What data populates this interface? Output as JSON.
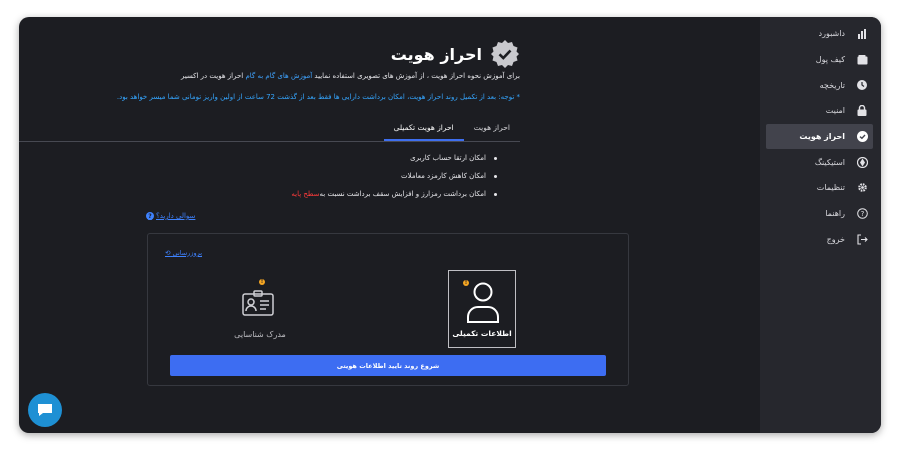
{
  "sidebar": {
    "items": [
      {
        "label": "داشبورد",
        "icon": "bar-chart-icon"
      },
      {
        "label": "کیف پول",
        "icon": "wallet-icon"
      },
      {
        "label": "تاریخچه",
        "icon": "clock-icon"
      },
      {
        "label": "امنیت",
        "icon": "lock-icon"
      },
      {
        "label": "احراز هویت",
        "icon": "check-circle-icon",
        "active": true
      },
      {
        "label": "استیکینگ",
        "icon": "staking-icon"
      },
      {
        "label": "تنظیمات",
        "icon": "gear-icon"
      },
      {
        "label": "راهنما",
        "icon": "help-icon"
      },
      {
        "label": "خروج",
        "icon": "logout-icon"
      }
    ]
  },
  "header": {
    "title": "احراز هویت",
    "badge_icon": "verified-badge-icon"
  },
  "tutorial": {
    "prefix": "برای آموزش نحوه احراز هویت ، از آموزش های تصویری استفاده نمایید ",
    "link": "آموزش های گام به گام",
    "suffix": " احراز هویت در اکسیر"
  },
  "notice": "* توجه: بعد از تکمیل روند احراز هویت، امکان برداشت دارایی ها فقط بعد از گذشت 72 ساعت از اولین واریز تومانی شما میسر خواهد بود.",
  "tabs": [
    {
      "label": "احراز هویت",
      "active": false
    },
    {
      "label": "احراز هویت تکمیلی",
      "active": true
    }
  ],
  "bullets": [
    {
      "text": "امکان ارتقا حساب کاربری"
    },
    {
      "text": "امکان کاهش کارمزد معاملات"
    },
    {
      "text": "امکان برداشت رمزارز و افزایش سقف برداشت نسبت به",
      "highlight": "سطح پایه"
    }
  ],
  "faq_label": "سوالی دارید؟",
  "refresh_label": "بروزرسانی",
  "cards": {
    "additional_info": {
      "label": "اطلاعات تکمیلی",
      "icon": "user-icon"
    },
    "id_document": {
      "label": "مدرک شناسایی",
      "icon": "id-card-icon"
    }
  },
  "start_button": "شروع روند تایید اطلاعات هویتی",
  "chat_icon": "chat-icon",
  "colors": {
    "accent": "#3d6df2",
    "link": "#3fa3ff",
    "warning": "#f5a623",
    "danger": "#ff3b3b",
    "background": "#1c1d22",
    "sidebar": "#26272d"
  }
}
